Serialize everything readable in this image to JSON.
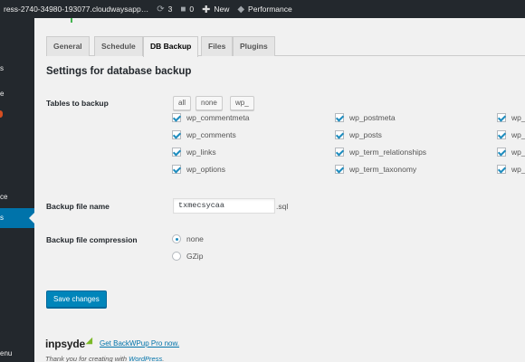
{
  "adminbar": {
    "site": "ress-2740-34980-193077.cloudwaysapp…",
    "updates_icon": "refresh-icon",
    "updates_count": "3",
    "comments_icon": "comment-icon",
    "comments_count": "0",
    "new_icon": "plus-icon",
    "new_label": "New",
    "performance_icon": "performance-icon",
    "performance_label": "Performance"
  },
  "sidebar": {
    "frag1": "s",
    "frag2": "e",
    "frag3": "ce",
    "frag4": "s",
    "collapse": "enu",
    "active_color": "#0073aa"
  },
  "tabs": [
    "General",
    "Schedule",
    "DB Backup",
    "Files",
    "Plugins"
  ],
  "active_tab": "DB Backup",
  "section_title": "Settings for database backup",
  "tables": {
    "label": "Tables to backup",
    "buttons": [
      "all",
      "none",
      "wp_"
    ],
    "items": [
      "wp_commentmeta",
      "wp_comments",
      "wp_links",
      "wp_options",
      "wp_postmeta",
      "wp_posts",
      "wp_term_relationships",
      "wp_term_taxonomy",
      "wp_",
      "wp_",
      "wp_",
      "wp_"
    ],
    "checked": true
  },
  "filename": {
    "label": "Backup file name",
    "value": "txmecsycaa",
    "extension": ".sql"
  },
  "compression": {
    "label": "Backup file compression",
    "options": [
      "none",
      "GZip"
    ],
    "selected": "none"
  },
  "save_label": "Save changes",
  "footer": {
    "logo": "inpsyde",
    "pro_link": "Get BackWPup Pro now.",
    "thanks_prefix": "Thank you for creating with ",
    "thanks_link": "WordPress",
    "thanks_suffix": "."
  },
  "colors": {
    "adminbar": "#23282d",
    "primary": "#0085ba",
    "link": "#0073aa",
    "check": "#1e8cbe",
    "accent_green": "#46b450"
  }
}
